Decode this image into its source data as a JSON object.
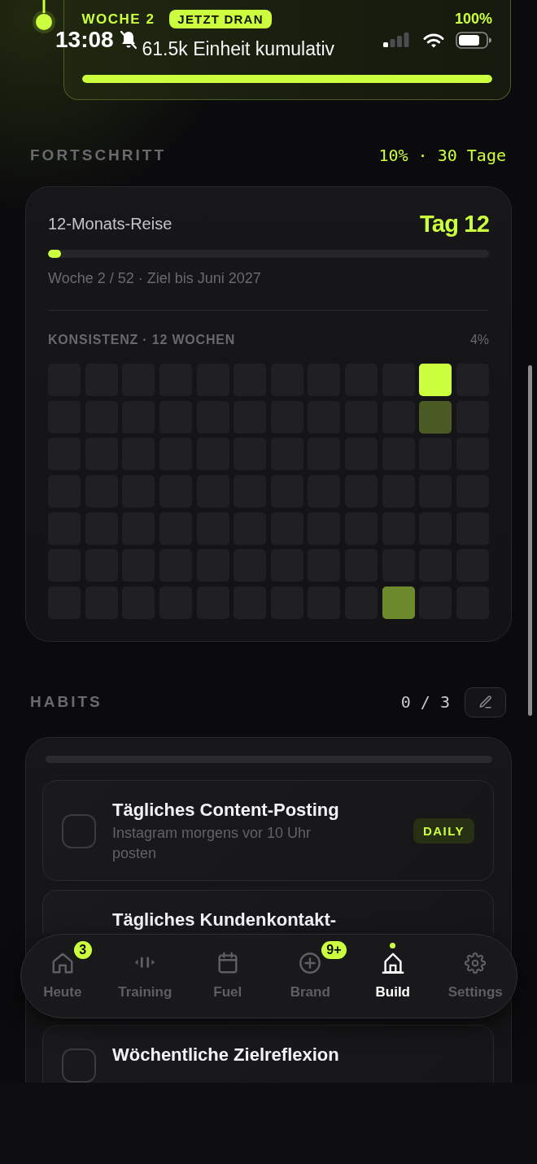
{
  "status_bar": {
    "time": "13:08",
    "silent": true
  },
  "week_card": {
    "week": "WOCHE 2",
    "badge": "JETZT DRAN",
    "percent": "100%",
    "summary": "61.5k Einheit kumulativ",
    "level": 1
  },
  "progress": {
    "title": "FORTSCHRITT",
    "summary": "10% · 30 Tage",
    "journey": {
      "title": "12-Monats-Reise",
      "day": "Tag 12",
      "level": 0.03,
      "caption": "Woche 2 / 52 · Ziel bis Juni 2027"
    },
    "consistency": {
      "title": "KONSISTENZ · 12 WOCHEN",
      "percent": "4%",
      "rows": [
        [
          {
            "color": "#202023"
          },
          {
            "color": "#202023"
          },
          {
            "color": "#202023"
          },
          {
            "color": "#202023"
          },
          {
            "color": "#202023"
          },
          {
            "color": "#202023"
          },
          {
            "color": "#202023"
          },
          {
            "color": "#202023"
          },
          {
            "color": "#202023"
          },
          {
            "color": "#202023"
          },
          {
            "color": "#ccff3d"
          },
          {
            "color": "#202023"
          }
        ],
        [
          {
            "color": "#202023"
          },
          {
            "color": "#202023"
          },
          {
            "color": "#202023"
          },
          {
            "color": "#202023"
          },
          {
            "color": "#202023"
          },
          {
            "color": "#202023"
          },
          {
            "color": "#202023"
          },
          {
            "color": "#202023"
          },
          {
            "color": "#202023"
          },
          {
            "color": "#202023"
          },
          {
            "color": "#4b5a24"
          },
          {
            "color": "#202023"
          }
        ],
        [
          {
            "color": "#202023"
          },
          {
            "color": "#202023"
          },
          {
            "color": "#202023"
          },
          {
            "color": "#202023"
          },
          {
            "color": "#202023"
          },
          {
            "color": "#202023"
          },
          {
            "color": "#202023"
          },
          {
            "color": "#202023"
          },
          {
            "color": "#202023"
          },
          {
            "color": "#202023"
          },
          {
            "color": "#202023"
          },
          {
            "color": "#202023"
          }
        ],
        [
          {
            "color": "#202023"
          },
          {
            "color": "#202023"
          },
          {
            "color": "#202023"
          },
          {
            "color": "#202023"
          },
          {
            "color": "#202023"
          },
          {
            "color": "#202023"
          },
          {
            "color": "#202023"
          },
          {
            "color": "#202023"
          },
          {
            "color": "#202023"
          },
          {
            "color": "#202023"
          },
          {
            "color": "#202023"
          },
          {
            "color": "#202023"
          }
        ],
        [
          {
            "color": "#202023"
          },
          {
            "color": "#202023"
          },
          {
            "color": "#202023"
          },
          {
            "color": "#202023"
          },
          {
            "color": "#202023"
          },
          {
            "color": "#202023"
          },
          {
            "color": "#202023"
          },
          {
            "color": "#202023"
          },
          {
            "color": "#202023"
          },
          {
            "color": "#202023"
          },
          {
            "color": "#202023"
          },
          {
            "color": "#202023"
          }
        ],
        [
          {
            "color": "#202023"
          },
          {
            "color": "#202023"
          },
          {
            "color": "#202023"
          },
          {
            "color": "#202023"
          },
          {
            "color": "#202023"
          },
          {
            "color": "#202023"
          },
          {
            "color": "#202023"
          },
          {
            "color": "#202023"
          },
          {
            "color": "#202023"
          },
          {
            "color": "#202023"
          },
          {
            "color": "#202023"
          },
          {
            "color": "#202023"
          }
        ],
        [
          {
            "color": "#202023"
          },
          {
            "color": "#202023"
          },
          {
            "color": "#202023"
          },
          {
            "color": "#202023"
          },
          {
            "color": "#202023"
          },
          {
            "color": "#202023"
          },
          {
            "color": "#202023"
          },
          {
            "color": "#202023"
          },
          {
            "color": "#202023"
          },
          {
            "color": "#6d8a2c"
          },
          {
            "color": "#202023"
          },
          {
            "color": "#202023"
          }
        ]
      ]
    }
  },
  "habits": {
    "title": "HABITS",
    "count": "0 / 3",
    "items": [
      {
        "title": "Tägliches Content-Posting",
        "subtitle": "Instagram morgens vor 10 Uhr posten",
        "checked": false,
        "badge": "DAILY"
      },
      {
        "title": "Tägliches Kundenkontakt-"
      },
      {
        "title": "Wöchentliche Zielreflexion",
        "checked": false
      }
    ]
  },
  "nav": {
    "tabs": [
      {
        "label": "Heute",
        "selected": false,
        "badge": "3"
      },
      {
        "label": "Training",
        "selected": false
      },
      {
        "label": "Fuel",
        "selected": false
      },
      {
        "label": "Brand",
        "selected": false,
        "badge": "9+"
      },
      {
        "label": "Build",
        "selected": true
      },
      {
        "label": "Settings",
        "selected": false
      }
    ]
  }
}
